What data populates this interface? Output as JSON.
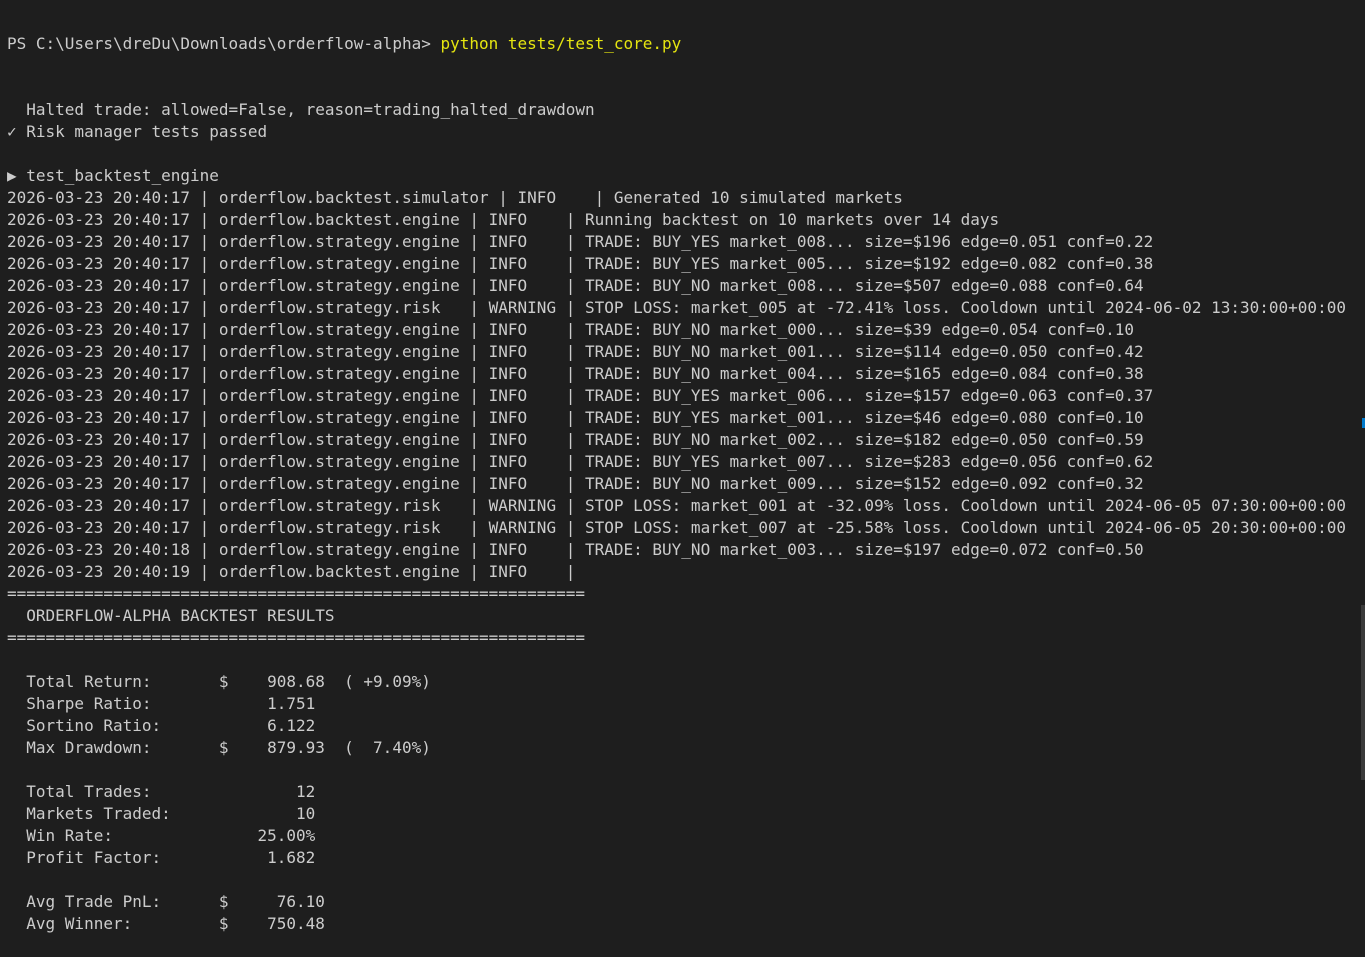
{
  "prompt": "PS C:\\Users\\dreDu\\Downloads\\orderflow-alpha>",
  "command": " python tests/test_core.py",
  "output": [
    "  Halted trade: allowed=False, reason=trading_halted_drawdown",
    "✓ Risk manager tests passed",
    "",
    "▶ test_backtest_engine",
    "2026-03-23 20:40:17 | orderflow.backtest.simulator | INFO    | Generated 10 simulated markets",
    "2026-03-23 20:40:17 | orderflow.backtest.engine | INFO    | Running backtest on 10 markets over 14 days",
    "2026-03-23 20:40:17 | orderflow.strategy.engine | INFO    | TRADE: BUY_YES market_008... size=$196 edge=0.051 conf=0.22",
    "2026-03-23 20:40:17 | orderflow.strategy.engine | INFO    | TRADE: BUY_YES market_005... size=$192 edge=0.082 conf=0.38",
    "2026-03-23 20:40:17 | orderflow.strategy.engine | INFO    | TRADE: BUY_NO market_008... size=$507 edge=0.088 conf=0.64",
    "2026-03-23 20:40:17 | orderflow.strategy.risk   | WARNING | STOP LOSS: market_005 at -72.41% loss. Cooldown until 2024-06-02 13:30:00+00:00",
    "2026-03-23 20:40:17 | orderflow.strategy.engine | INFO    | TRADE: BUY_NO market_000... size=$39 edge=0.054 conf=0.10",
    "2026-03-23 20:40:17 | orderflow.strategy.engine | INFO    | TRADE: BUY_NO market_001... size=$114 edge=0.050 conf=0.42",
    "2026-03-23 20:40:17 | orderflow.strategy.engine | INFO    | TRADE: BUY_NO market_004... size=$165 edge=0.084 conf=0.38",
    "2026-03-23 20:40:17 | orderflow.strategy.engine | INFO    | TRADE: BUY_YES market_006... size=$157 edge=0.063 conf=0.37",
    "2026-03-23 20:40:17 | orderflow.strategy.engine | INFO    | TRADE: BUY_YES market_001... size=$46 edge=0.080 conf=0.10",
    "2026-03-23 20:40:17 | orderflow.strategy.engine | INFO    | TRADE: BUY_NO market_002... size=$182 edge=0.050 conf=0.59",
    "2026-03-23 20:40:17 | orderflow.strategy.engine | INFO    | TRADE: BUY_YES market_007... size=$283 edge=0.056 conf=0.62",
    "2026-03-23 20:40:17 | orderflow.strategy.engine | INFO    | TRADE: BUY_NO market_009... size=$152 edge=0.092 conf=0.32",
    "2026-03-23 20:40:17 | orderflow.strategy.risk   | WARNING | STOP LOSS: market_001 at -32.09% loss. Cooldown until 2024-06-05 07:30:00+00:00",
    "2026-03-23 20:40:17 | orderflow.strategy.risk   | WARNING | STOP LOSS: market_007 at -25.58% loss. Cooldown until 2024-06-05 20:30:00+00:00",
    "2026-03-23 20:40:18 | orderflow.strategy.engine | INFO    | TRADE: BUY_NO market_003... size=$197 edge=0.072 conf=0.50",
    "2026-03-23 20:40:19 | orderflow.backtest.engine | INFO    |",
    "============================================================",
    "  ORDERFLOW-ALPHA BACKTEST RESULTS",
    "============================================================",
    "",
    "  Total Return:       $    908.68  ( +9.09%)",
    "  Sharpe Ratio:            1.751",
    "  Sortino Ratio:           6.122",
    "  Max Drawdown:       $    879.93  (  7.40%)",
    "",
    "  Total Trades:               12",
    "  Markets Traded:             10",
    "  Win Rate:               25.00%",
    "  Profit Factor:           1.682",
    "",
    "  Avg Trade PnL:      $     76.10",
    "  Avg Winner:         $    750.48"
  ],
  "colors": {
    "background": "#1e1e1e",
    "foreground": "#cccccc",
    "command": "#e5e510",
    "scroll_marker": "#007acc"
  }
}
